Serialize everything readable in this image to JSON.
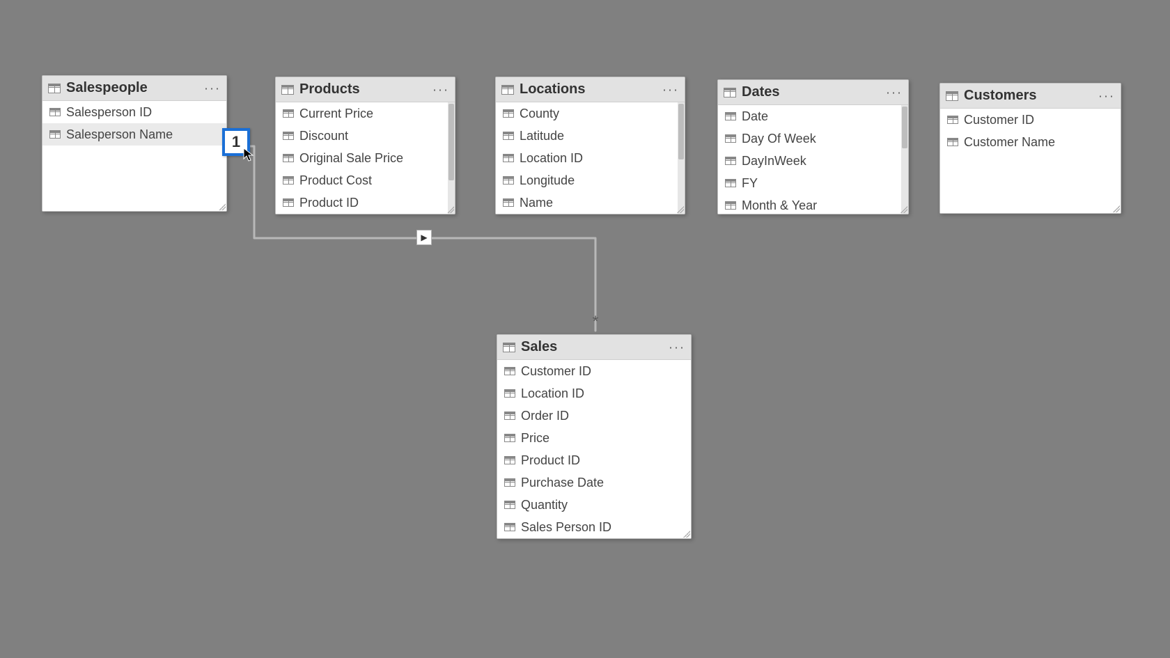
{
  "tables": {
    "salespeople": {
      "title": "Salespeople",
      "fields": [
        "Salesperson ID",
        "Salesperson Name"
      ]
    },
    "products": {
      "title": "Products",
      "fields": [
        "Current Price",
        "Discount",
        "Original Sale Price",
        "Product Cost",
        "Product ID"
      ]
    },
    "locations": {
      "title": "Locations",
      "fields": [
        "County",
        "Latitude",
        "Location ID",
        "Longitude",
        "Name"
      ]
    },
    "dates": {
      "title": "Dates",
      "fields": [
        "Date",
        "Day Of Week",
        "DayInWeek",
        "FY",
        "Month & Year"
      ]
    },
    "customers": {
      "title": "Customers",
      "fields": [
        "Customer ID",
        "Customer Name"
      ]
    },
    "sales": {
      "title": "Sales",
      "fields": [
        "Customer ID",
        "Location ID",
        "Order ID",
        "Price",
        "Product ID",
        "Purchase Date",
        "Quantity",
        "Sales Person ID"
      ]
    }
  },
  "relationship": {
    "from_table": "Salespeople",
    "to_table": "Sales",
    "from_cardinality": "1",
    "to_cardinality": "*",
    "direction_icon": "▶"
  },
  "menu_glyph": "···"
}
